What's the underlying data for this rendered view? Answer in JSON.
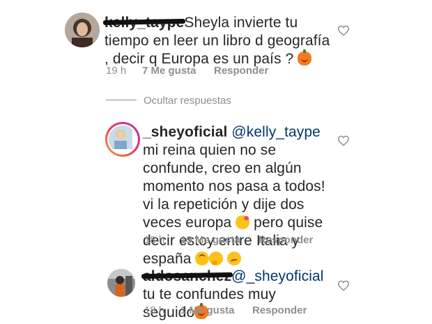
{
  "comments": [
    {
      "username": "kelly_taype",
      "text": "Sheyla invierte tu tiempo en leer un libro d geografía , decir q Europa es un país ?",
      "time": "19 h",
      "likes": "7 Me gusta",
      "reply": "Responder"
    },
    {
      "username": "_sheyoficial",
      "mention": "@kelly_taype",
      "text_1": " mi reina quien no se confunde, creo en algún momento nos pasa a todos! vi la repetición y dije dos veces europa",
      "text_2": " pero quise decir estoy entre Italia y españa",
      "time": "18 h",
      "likes": "19 Me gusta",
      "reply": "Responder"
    },
    {
      "username": "aldosanchez",
      "mention": "@_sheyoficial",
      "text": " tu te confundes muy seguido",
      "time": "18 h",
      "likes": "1 Me gusta",
      "reply": "Responder"
    }
  ],
  "hide_replies": "Ocultar respuestas",
  "icons": [
    "heart-outline-icon",
    "pumpkin-emoji-icon",
    "kissing-emoji-icon",
    "upside-down-emoji-icon",
    "thinking-emoji-icon",
    "woozy-emoji-icon"
  ]
}
